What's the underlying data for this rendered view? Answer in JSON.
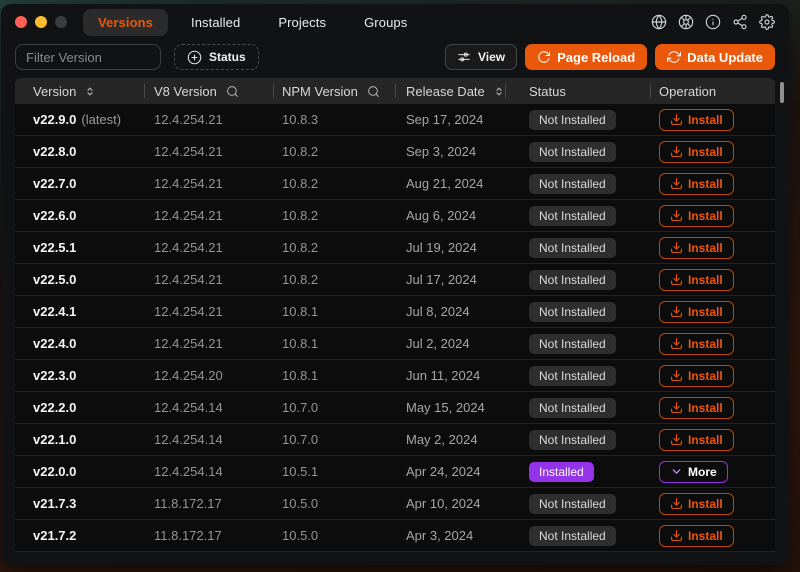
{
  "window": {
    "tabs": [
      {
        "label": "Versions",
        "active": true
      },
      {
        "label": "Installed",
        "active": false
      },
      {
        "label": "Projects",
        "active": false
      },
      {
        "label": "Groups",
        "active": false
      }
    ],
    "titlebar_icons": [
      "globe",
      "color-wheel",
      "info",
      "share",
      "settings"
    ]
  },
  "toolbar": {
    "filter_placeholder": "Filter Version",
    "status_label": "Status",
    "view_label": "View",
    "page_reload_label": "Page Reload",
    "data_update_label": "Data Update"
  },
  "table": {
    "columns": [
      {
        "label": "Version",
        "icon": "sort"
      },
      {
        "label": "V8 Version",
        "icon": "search"
      },
      {
        "label": "NPM Version",
        "icon": "search"
      },
      {
        "label": "Release Date",
        "icon": "sort"
      },
      {
        "label": "Status",
        "icon": ""
      },
      {
        "label": "Operation",
        "icon": ""
      }
    ],
    "rows": [
      {
        "version": "v22.9.0",
        "tag": "(latest)",
        "v8": "12.4.254.21",
        "npm": "10.8.3",
        "date": "Sep 17, 2024",
        "status": "Not Installed",
        "installed": false,
        "action": "Install"
      },
      {
        "version": "v22.8.0",
        "tag": "",
        "v8": "12.4.254.21",
        "npm": "10.8.2",
        "date": "Sep 3, 2024",
        "status": "Not Installed",
        "installed": false,
        "action": "Install"
      },
      {
        "version": "v22.7.0",
        "tag": "",
        "v8": "12.4.254.21",
        "npm": "10.8.2",
        "date": "Aug 21, 2024",
        "status": "Not Installed",
        "installed": false,
        "action": "Install"
      },
      {
        "version": "v22.6.0",
        "tag": "",
        "v8": "12.4.254.21",
        "npm": "10.8.2",
        "date": "Aug 6, 2024",
        "status": "Not Installed",
        "installed": false,
        "action": "Install"
      },
      {
        "version": "v22.5.1",
        "tag": "",
        "v8": "12.4.254.21",
        "npm": "10.8.2",
        "date": "Jul 19, 2024",
        "status": "Not Installed",
        "installed": false,
        "action": "Install"
      },
      {
        "version": "v22.5.0",
        "tag": "",
        "v8": "12.4.254.21",
        "npm": "10.8.2",
        "date": "Jul 17, 2024",
        "status": "Not Installed",
        "installed": false,
        "action": "Install"
      },
      {
        "version": "v22.4.1",
        "tag": "",
        "v8": "12.4.254.21",
        "npm": "10.8.1",
        "date": "Jul 8, 2024",
        "status": "Not Installed",
        "installed": false,
        "action": "Install"
      },
      {
        "version": "v22.4.0",
        "tag": "",
        "v8": "12.4.254.21",
        "npm": "10.8.1",
        "date": "Jul 2, 2024",
        "status": "Not Installed",
        "installed": false,
        "action": "Install"
      },
      {
        "version": "v22.3.0",
        "tag": "",
        "v8": "12.4.254.20",
        "npm": "10.8.1",
        "date": "Jun 11, 2024",
        "status": "Not Installed",
        "installed": false,
        "action": "Install"
      },
      {
        "version": "v22.2.0",
        "tag": "",
        "v8": "12.4.254.14",
        "npm": "10.7.0",
        "date": "May 15, 2024",
        "status": "Not Installed",
        "installed": false,
        "action": "Install"
      },
      {
        "version": "v22.1.0",
        "tag": "",
        "v8": "12.4.254.14",
        "npm": "10.7.0",
        "date": "May 2, 2024",
        "status": "Not Installed",
        "installed": false,
        "action": "Install"
      },
      {
        "version": "v22.0.0",
        "tag": "",
        "v8": "12.4.254.14",
        "npm": "10.5.1",
        "date": "Apr 24, 2024",
        "status": "Installed",
        "installed": true,
        "action": "More"
      },
      {
        "version": "v21.7.3",
        "tag": "",
        "v8": "11.8.172.17",
        "npm": "10.5.0",
        "date": "Apr 10, 2024",
        "status": "Not Installed",
        "installed": false,
        "action": "Install"
      },
      {
        "version": "v21.7.2",
        "tag": "",
        "v8": "11.8.172.17",
        "npm": "10.5.0",
        "date": "Apr 3, 2024",
        "status": "Not Installed",
        "installed": false,
        "action": "Install"
      }
    ],
    "row_actions": {
      "install_label": "Install",
      "more_label": "More"
    }
  },
  "colors": {
    "accent_orange": "#ea580c",
    "accent_purple": "#9333ea"
  }
}
